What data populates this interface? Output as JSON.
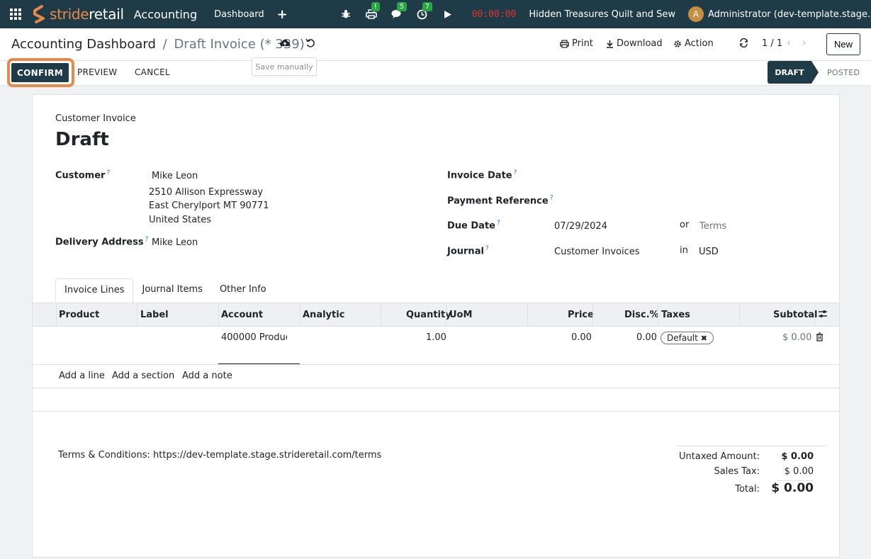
{
  "navbar": {
    "brand_prefix": "stride",
    "brand_suffix": "retail",
    "app_name": "Accounting",
    "dashboard_link": "Dashboard",
    "plus": "+",
    "print_badge": "!",
    "messages_badge": "5",
    "activity_badge": "7",
    "timer": "00:00:00",
    "company": "Hidden Treasures Quilt and Sew",
    "avatar_letter": "A",
    "user": "Administrator (dev-template.stage.strideretail.com)"
  },
  "control": {
    "breadcrumb_parent": "Accounting Dashboard",
    "breadcrumb_sep": "/",
    "breadcrumb_current": "Draft Invoice (* 339)",
    "tooltip": "Save manually",
    "print": "Print",
    "download": "Download",
    "action": "Action",
    "pager": "1 / 1",
    "new": "New"
  },
  "statusbar": {
    "confirm": "CONFIRM",
    "preview": "PREVIEW",
    "cancel": "CANCEL",
    "stage_draft": "DRAFT",
    "stage_posted": "POSTED"
  },
  "form": {
    "type": "Customer Invoice",
    "title": "Draft",
    "customer_label": "Customer",
    "customer_name": "Mike Leon",
    "address_line1": "2510 Allison Expressway",
    "address_line2": "East Cherylport MT 90771",
    "address_line3": "United States",
    "delivery_label": "Delivery Address",
    "delivery_name": "Mike Leon",
    "invoice_date_label": "Invoice Date",
    "payment_ref_label": "Payment Reference",
    "due_date_label": "Due Date",
    "due_date": "07/29/2024",
    "or": "or",
    "terms_placeholder": "Terms",
    "journal_label": "Journal",
    "journal": "Customer Invoices",
    "in": "in",
    "currency": "USD",
    "help": "?"
  },
  "tabs": [
    "Invoice Lines",
    "Journal Items",
    "Other Info"
  ],
  "table": {
    "headers": {
      "product": "Product",
      "label": "Label",
      "account": "Account",
      "analytic": "Analytic",
      "quantity": "Quantity",
      "uom": "UoM",
      "price": "Price",
      "disc": "Disc.%",
      "taxes": "Taxes",
      "subtotal": "Subtotal"
    },
    "row": {
      "account": "400000 Produc",
      "quantity": "1.00",
      "price": "0.00",
      "disc": "0.00",
      "tax": "Default",
      "subtotal": "$ 0.00"
    },
    "add_line": "Add a line",
    "add_section": "Add a section",
    "add_note": "Add a note"
  },
  "footer": {
    "terms": "Terms & Conditions: https://dev-template.stage.strideretail.com/terms",
    "untaxed_label": "Untaxed Amount:",
    "untaxed": "$ 0.00",
    "tax_label": "Sales Tax:",
    "tax": "$ 0.00",
    "total_label": "Total:",
    "total": "$ 0.00"
  },
  "colors": {
    "navbar": "#1f3b47",
    "accent": "#e8894a",
    "timer": "#e2332d",
    "badge": "#28a745"
  }
}
